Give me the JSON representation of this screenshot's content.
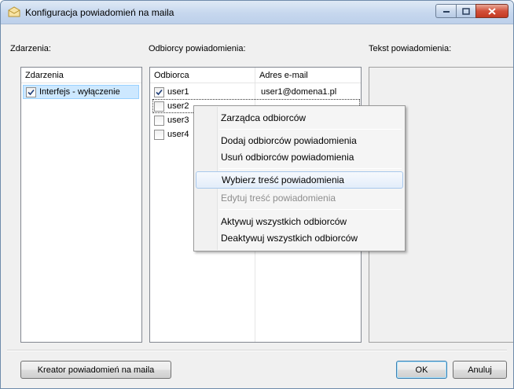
{
  "window": {
    "title": "Konfiguracja powiadomień na maila"
  },
  "labels": {
    "events": "Zdarzenia:",
    "recipients": "Odbiorcy powiadomienia:",
    "text": "Tekst powiadomienia:"
  },
  "events_list": {
    "header": "Zdarzenia",
    "items": [
      {
        "label": "Interfejs - wyłączenie",
        "checked": true
      }
    ]
  },
  "recipients_list": {
    "columns": [
      "Odbiorca",
      "Adres e-mail"
    ],
    "rows": [
      {
        "name": "user1",
        "email": "user1@domena1.pl",
        "checked": true
      },
      {
        "name": "user2",
        "email": "",
        "checked": false
      },
      {
        "name": "user3",
        "email": "",
        "checked": false
      },
      {
        "name": "user4",
        "email": "",
        "checked": false
      }
    ]
  },
  "context_menu": {
    "items": [
      {
        "label": "Zarządca odbiorców",
        "disabled": false
      },
      {
        "label": "Dodaj odbiorców powiadomienia",
        "disabled": false
      },
      {
        "label": "Usuń odbiorców powiadomienia",
        "disabled": false
      },
      {
        "label": "Wybierz treść powiadomienia",
        "disabled": false,
        "highlighted": true
      },
      {
        "label": "Edytuj treść powiadomienia",
        "disabled": true
      },
      {
        "label": "Aktywuj wszystkich odbiorców",
        "disabled": false
      },
      {
        "label": "Deaktywuj wszystkich odbiorców",
        "disabled": false
      }
    ]
  },
  "buttons": {
    "wizard": "Kreator powiadomień na maila",
    "ok": "OK",
    "cancel": "Anuluj"
  },
  "colors": {
    "titlebar": "#c6d7ee",
    "close_button": "#d2503a",
    "menu_highlight": "#e3edfa",
    "selection": "#cde8ff"
  }
}
